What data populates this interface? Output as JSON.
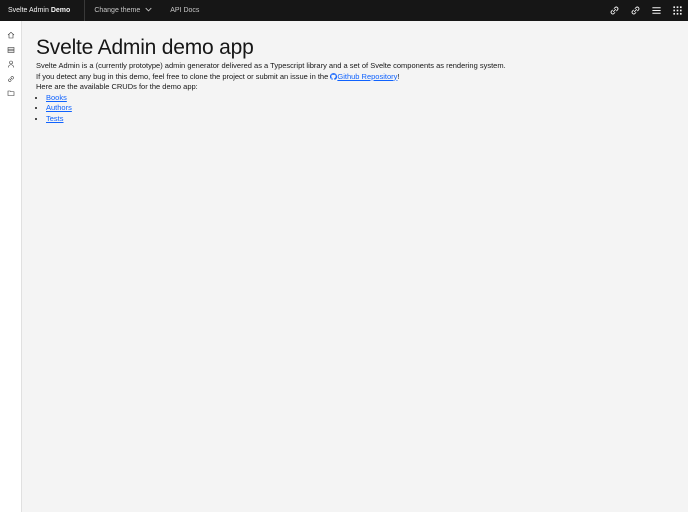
{
  "header": {
    "brand_prefix": "Svelte Admin",
    "brand_bold": "Demo",
    "nav": [
      {
        "label": "Change theme",
        "icon": "chevron-down-icon"
      },
      {
        "label": "API Docs"
      }
    ],
    "actions": [
      "link-icon",
      "link-icon",
      "menu-icon",
      "app-switcher-icon"
    ]
  },
  "sidebar": {
    "items": [
      "home-icon",
      "books-icon",
      "user-icon",
      "link-icon",
      "folder-icon"
    ]
  },
  "main": {
    "title": "Svelte Admin demo app",
    "intro": "Svelte Admin is a (currently prototype) admin generator delivered as a Typescript library and a set of Svelte components as rendering system.",
    "bug_prefix": "If you detect any bug in this demo, feel free to clone the project or submit an issue in the",
    "repo_link": "Github Repository",
    "bug_suffix": "!",
    "cruds_intro": "Here are the available CRUDs for the demo app:",
    "cruds": [
      "Books",
      "Authors",
      "Tests"
    ]
  },
  "colors": {
    "header_bg": "#161616",
    "page_bg": "#f4f4f4",
    "link": "#0f62fe"
  }
}
